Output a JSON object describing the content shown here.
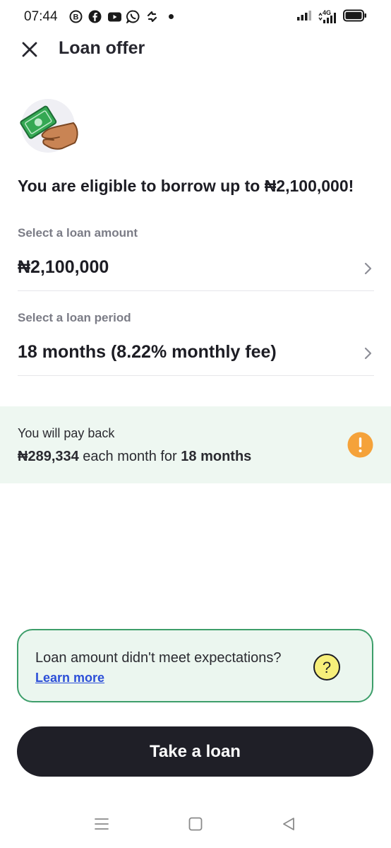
{
  "status_bar": {
    "time": "07:44",
    "network": "4G",
    "app_icons": [
      "bold-b-icon",
      "facebook-icon",
      "youtube-icon",
      "whatsapp-icon",
      "sync-icon"
    ]
  },
  "header": {
    "title": "Loan offer",
    "close_icon": "close-icon"
  },
  "offer": {
    "eligible_text": "You are eligible to borrow up to ₦2,100,000!"
  },
  "amount": {
    "label": "Select a loan amount",
    "value": "₦2,100,000"
  },
  "period": {
    "label": "Select a loan period",
    "value": "18 months (8.22% monthly fee)"
  },
  "payback": {
    "intro": "You will pay back",
    "amount": "₦289,334",
    "middle": " each month for ",
    "duration": "18 months"
  },
  "info_card": {
    "text": "Loan amount didn't meet expectations?",
    "link": "Learn more"
  },
  "cta": {
    "label": "Take a loan"
  },
  "colors": {
    "accent_green": "#3d9e6a",
    "warning_orange": "#f5a23a",
    "help_yellow": "#f7ef7a",
    "link_blue": "#2c4fd8",
    "button_dark": "#1f1f27"
  }
}
